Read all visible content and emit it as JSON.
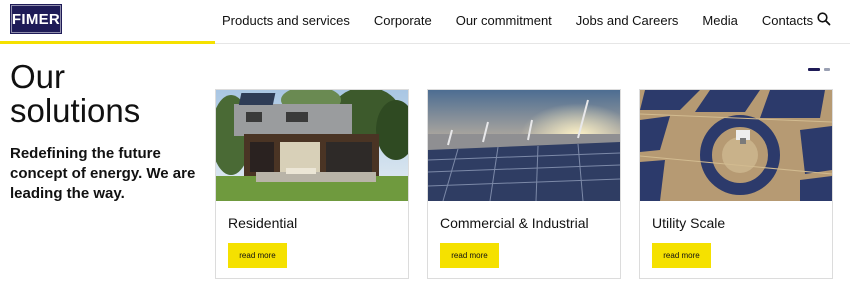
{
  "brand": {
    "logo_text": "FIMER"
  },
  "nav": {
    "items": [
      {
        "label": "Products and services"
      },
      {
        "label": "Corporate"
      },
      {
        "label": "Our commitment"
      },
      {
        "label": "Jobs and Careers"
      },
      {
        "label": "Media"
      },
      {
        "label": "Contacts"
      }
    ],
    "search_icon": "search-icon"
  },
  "hero": {
    "title_line1": "Our",
    "title_line2": "solutions",
    "subtitle": "Redefining the future concept of energy. We are leading the way."
  },
  "slider": {
    "pages": 2,
    "active_index": 0
  },
  "cards": [
    {
      "title": "Residential",
      "button": "read more",
      "image": "house-with-rooftop-solar-photo"
    },
    {
      "title": "Commercial & Industrial",
      "button": "read more",
      "image": "industrial-rooftop-solar-panels-photo"
    },
    {
      "title": "Utility Scale",
      "button": "read more",
      "image": "solar-farm-aerial-photo"
    }
  ],
  "colors": {
    "brand_navy": "#1e1b57",
    "accent_yellow": "#f5e100"
  }
}
